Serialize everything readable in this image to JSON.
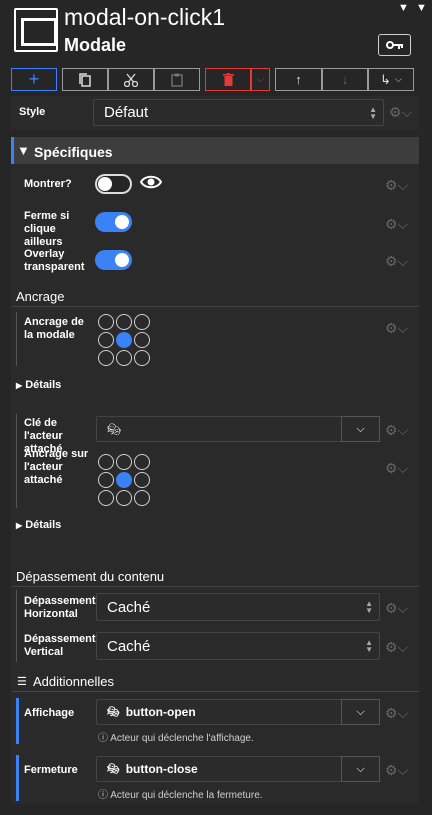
{
  "header": {
    "title": "modal-on-click1",
    "subtitle": "Modale",
    "key_icon": "key-icon"
  },
  "toolbar": {
    "add": "+",
    "copy_icon": "copy-icon",
    "cut_icon": "scissors-icon",
    "paste_icon": "clipboard-icon",
    "delete_icon": "trash-icon",
    "delete_color": "#e53935",
    "up": "↑",
    "down": "↓",
    "more": "↳"
  },
  "style": {
    "label": "Style",
    "value": "Défaut"
  },
  "specifiques": {
    "title": "Spécifiques",
    "montrer": {
      "label": "Montrer?",
      "on": false
    },
    "ferme": {
      "label": "Ferme si clique ailleurs",
      "on": true
    },
    "overlay": {
      "label": "Overlay transparent",
      "on": true
    }
  },
  "ancrage": {
    "title": "Ancrage",
    "label": "Ancrage de la modale",
    "details": "Détails",
    "cle_label": "Clé de l'acteur attaché",
    "sur_label": "Ancrage sur l'acteur attaché",
    "details2": "Détails"
  },
  "depassement": {
    "title": "Dépassement du contenu",
    "horizontal": {
      "label": "Dépassement Horizontal",
      "value": "Caché"
    },
    "vertical": {
      "label": "Dépassement Vertical",
      "value": "Caché"
    }
  },
  "additionnelles": {
    "title": "Additionnelles",
    "affichage": {
      "label": "Affichage",
      "value": "button-open",
      "help": "Acteur qui déclenche l'affichage."
    },
    "fermeture": {
      "label": "Fermeture",
      "value": "button-close",
      "help": "Acteur qui déclenche la fermeture."
    }
  },
  "colors": {
    "accent": "#3b82f6",
    "background": "#262626"
  }
}
